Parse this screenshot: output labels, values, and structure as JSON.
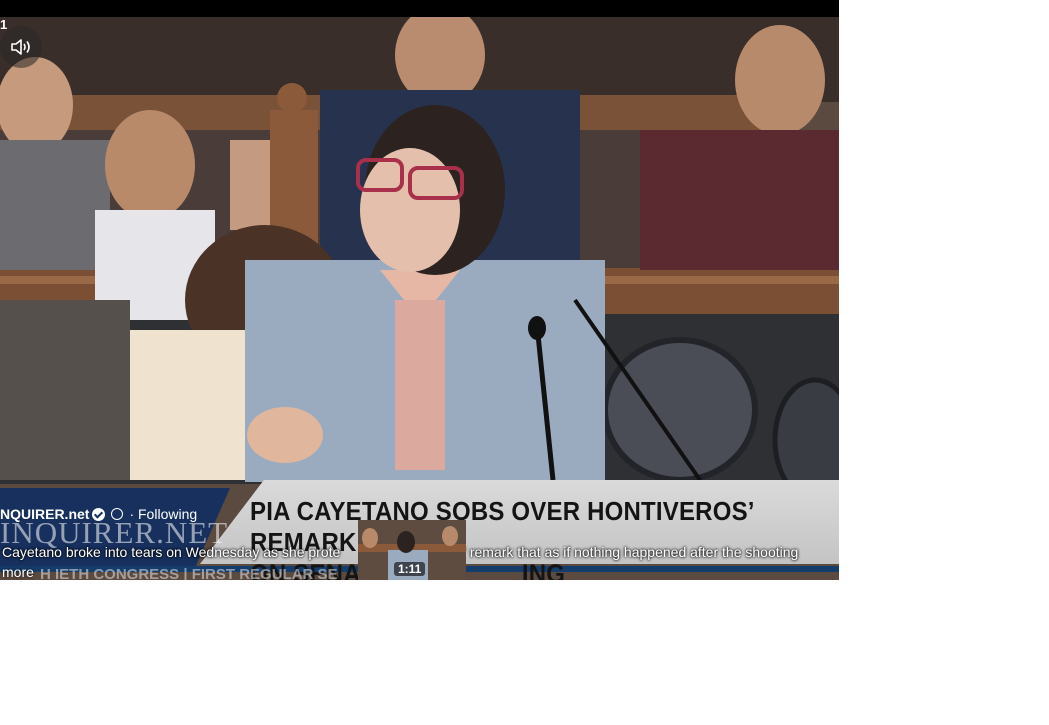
{
  "video": {
    "corner_glyph": "1",
    "mute_button_icon": "volume-icon",
    "lower_third": {
      "headline_line1": "PIA CAYETANO SOBS OVER HONTIVEROS’ REMARK",
      "headline_line2": "ON SENAT",
      "headline_line2_end": "ING",
      "brand_watermark": "INQUIRER.NET",
      "ghost_text": "H IETH CONGRESS | FIRST REGULAR SE"
    },
    "thumbnail": {
      "duration": "1:11"
    }
  },
  "post": {
    "page_name": "NQUIRER.net",
    "following_label": "· Following",
    "caption": "Cayetano broke into tears on Wednesday as she prote",
    "caption_tail": "s' remark that as if nothing happened after the shooting",
    "more_label": "more"
  },
  "colors": {
    "navy": "#17305e",
    "strip_blue": "#153d6b",
    "headline_gray": "#d0d0d0"
  }
}
